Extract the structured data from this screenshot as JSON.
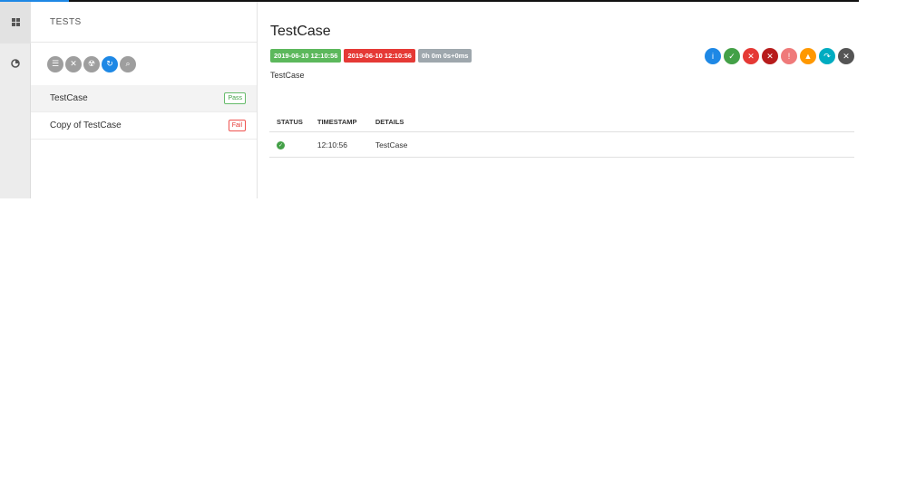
{
  "nav": {
    "items": [
      {
        "icon": "dashboard-grid-icon"
      },
      {
        "icon": "chart-pie-icon"
      }
    ]
  },
  "tests_pane": {
    "header": "TESTS",
    "filters": [
      {
        "icon": "list-icon",
        "glyph": "☰",
        "color": "#9e9e9e"
      },
      {
        "icon": "close-icon",
        "glyph": "✕",
        "color": "#9e9e9e"
      },
      {
        "icon": "radiation-icon",
        "glyph": "☢",
        "color": "#9e9e9e"
      },
      {
        "icon": "refresh-icon",
        "glyph": "↻",
        "color": "#1e88e5"
      },
      {
        "icon": "search-icon",
        "glyph": "⌕",
        "color": "#9e9e9e"
      }
    ],
    "items": [
      {
        "name": "TestCase",
        "status": "Pass"
      },
      {
        "name": "Copy of TestCase",
        "status": "Fail"
      }
    ]
  },
  "detail": {
    "title": "TestCase",
    "start_time": "2019-06-10 12:10:56",
    "end_time": "2019-06-10 12:10:56",
    "duration": "0h 0m 0s+0ms",
    "description": "TestCase",
    "status_filters": [
      {
        "icon": "info-icon",
        "glyph": "i",
        "color": "#1e88e5"
      },
      {
        "icon": "pass-icon",
        "glyph": "✓",
        "color": "#43a047"
      },
      {
        "icon": "fail-icon",
        "glyph": "✕",
        "color": "#e53935"
      },
      {
        "icon": "fatal-icon",
        "glyph": "✕",
        "color": "#b71c1c"
      },
      {
        "icon": "error-icon",
        "glyph": "!",
        "color": "#ef7a7a"
      },
      {
        "icon": "warning-icon",
        "glyph": "▲",
        "color": "#ff9800"
      },
      {
        "icon": "skip-icon",
        "glyph": "↷",
        "color": "#00acc1"
      },
      {
        "icon": "clear-icon",
        "glyph": "✕",
        "color": "#555555"
      }
    ],
    "log": {
      "headers": [
        "STATUS",
        "TIMESTAMP",
        "DETAILS"
      ],
      "rows": [
        {
          "status": "pass",
          "timestamp": "12:10:56",
          "details": "TestCase"
        }
      ]
    }
  }
}
